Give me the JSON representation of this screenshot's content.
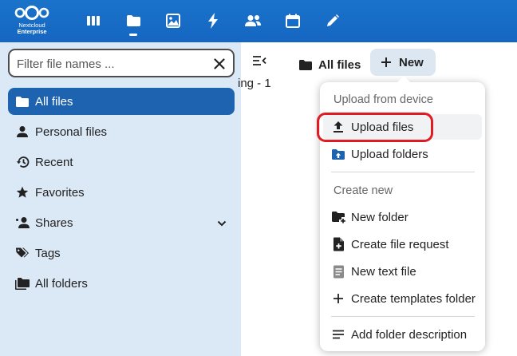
{
  "header": {
    "brand": {
      "line1": "Nextcloud",
      "line2": "Enterprise"
    },
    "apps": [
      {
        "name": "dashboard",
        "icon": "dashboard-icon"
      },
      {
        "name": "files",
        "icon": "folder-icon",
        "active": true
      },
      {
        "name": "photos",
        "icon": "image-icon"
      },
      {
        "name": "activity",
        "icon": "lightning-icon"
      },
      {
        "name": "contacts",
        "icon": "contacts-icon"
      },
      {
        "name": "calendar",
        "icon": "calendar-icon"
      },
      {
        "name": "notes",
        "icon": "pencil-icon"
      }
    ]
  },
  "sidebar": {
    "search": {
      "placeholder": "Filter file names ..."
    },
    "items": [
      {
        "label": "All files",
        "icon": "folder-icon",
        "active": true
      },
      {
        "label": "Personal files",
        "icon": "account-icon"
      },
      {
        "label": "Recent",
        "icon": "history-icon"
      },
      {
        "label": "Favorites",
        "icon": "star-icon"
      },
      {
        "label": "Shares",
        "icon": "share-icon",
        "expandable": true
      },
      {
        "label": "Tags",
        "icon": "tag-icon"
      },
      {
        "label": "All folders",
        "icon": "folder-multiple-icon"
      }
    ]
  },
  "main": {
    "breadcrumb": "All files",
    "new_button": "New",
    "background_text": "ing - 1"
  },
  "menu": {
    "upload_section": "Upload from device",
    "upload_items": [
      {
        "label": "Upload files",
        "icon": "upload-icon"
      },
      {
        "label": "Upload folders",
        "icon": "folder-upload-icon"
      }
    ],
    "create_section": "Create new",
    "create_items": [
      {
        "label": "New folder",
        "icon": "folder-plus-icon"
      },
      {
        "label": "Create file request",
        "icon": "file-request-icon"
      },
      {
        "label": "New text file",
        "icon": "text-file-icon"
      },
      {
        "label": "Create templates folder",
        "icon": "plus-icon"
      }
    ],
    "extra_items": [
      {
        "label": "Add folder description",
        "icon": "description-icon"
      }
    ]
  },
  "colors": {
    "header_bg": "#1566c2",
    "sidebar_bg": "#dbe8f5",
    "active_item_bg": "#1e63b0",
    "highlight_ring": "#e01b24"
  }
}
